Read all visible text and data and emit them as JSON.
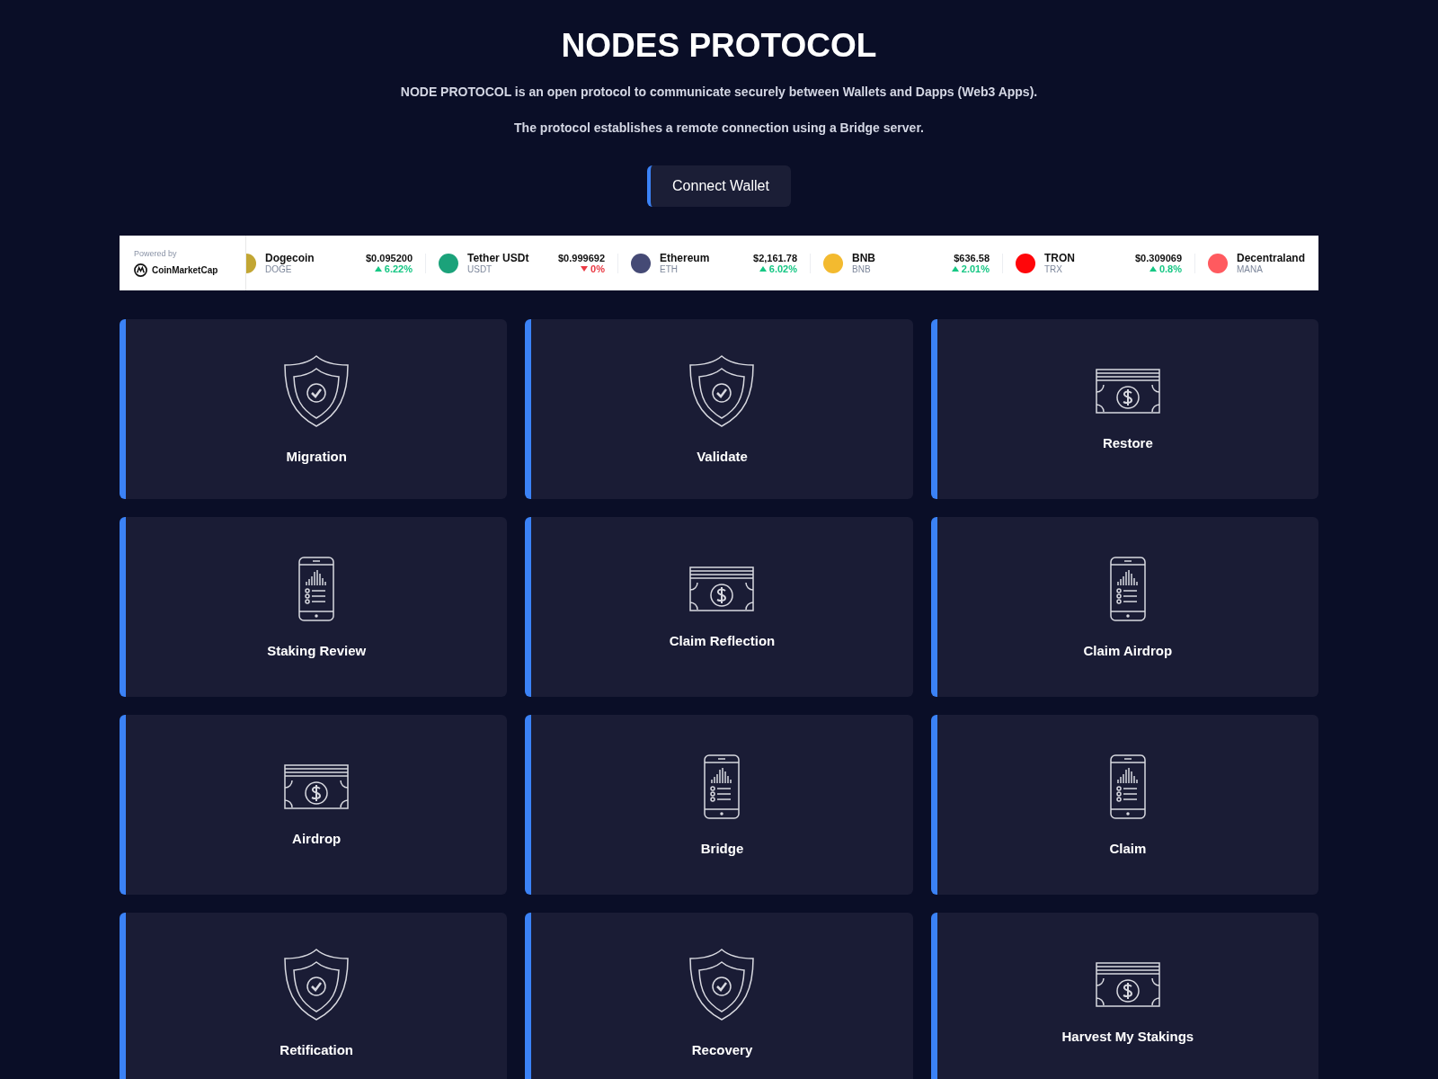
{
  "header": {
    "title": "NODES PROTOCOL",
    "lines": [
      "NODE PROTOCOL is an open protocol to communicate securely between Wallets and Dapps (Web3 Apps).",
      "The protocol establishes a remote connection using a Bridge server."
    ],
    "button": "Connect Wallet"
  },
  "ticker": {
    "powered_by": "Powered by",
    "brand": "CoinMarketCap",
    "coins": [
      {
        "name": "Dogecoin",
        "symbol": "DOGE",
        "price": "$0.095200",
        "change": "6.22%",
        "rising": true,
        "color": "#c2a633"
      },
      {
        "name": "Tether USDt",
        "symbol": "USDT",
        "price": "$0.999692",
        "change": "0%",
        "rising": false,
        "color": "#1ba27a"
      },
      {
        "name": "Ethereum",
        "symbol": "ETH",
        "price": "$2,161.78",
        "change": "6.02%",
        "rising": true,
        "color": "#454a75"
      },
      {
        "name": "BNB",
        "symbol": "BNB",
        "price": "$636.58",
        "change": "2.01%",
        "rising": true,
        "color": "#f3ba2f"
      },
      {
        "name": "TRON",
        "symbol": "TRX",
        "price": "$0.309069",
        "change": "0.8%",
        "rising": true,
        "color": "#ff060a"
      },
      {
        "name": "Decentraland",
        "symbol": "MANA",
        "color": "#ff5a5f"
      }
    ]
  },
  "cards": [
    {
      "label": "Migration",
      "kind": "shield"
    },
    {
      "label": "Validate",
      "kind": "shield"
    },
    {
      "label": "Restore",
      "kind": "money"
    },
    {
      "label": "Staking Review",
      "kind": "phone"
    },
    {
      "label": "Claim Reflection",
      "kind": "money"
    },
    {
      "label": "Claim Airdrop",
      "kind": "phone"
    },
    {
      "label": "Airdrop",
      "kind": "money"
    },
    {
      "label": "Bridge",
      "kind": "phone"
    },
    {
      "label": "Claim",
      "kind": "phone"
    },
    {
      "label": "Retification",
      "kind": "shield"
    },
    {
      "label": "Recovery",
      "kind": "shield"
    },
    {
      "label": "Harvest My Stakings",
      "kind": "money"
    }
  ]
}
